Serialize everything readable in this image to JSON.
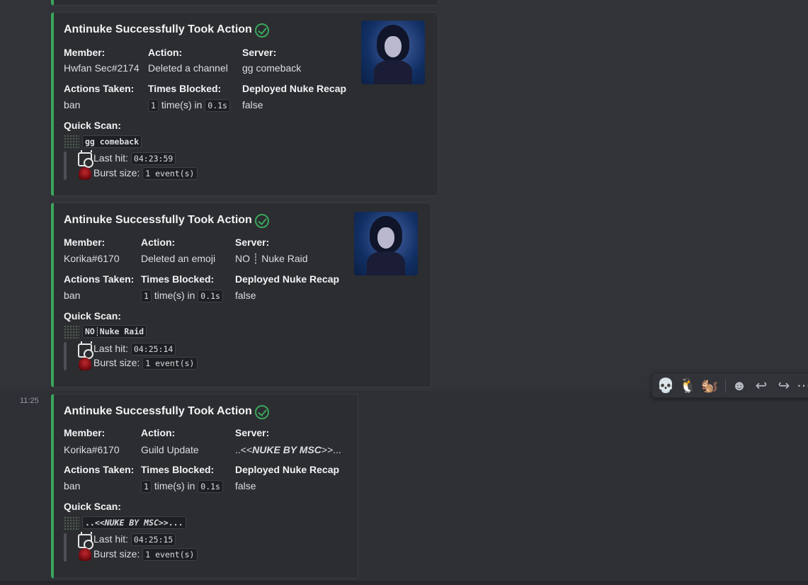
{
  "embeds": [
    {
      "title": "Antinuke Successfully Took Action",
      "member_label": "Member:",
      "member": "Hwfan Sec#2174",
      "action_label": "Action:",
      "action": "Deleted a channel",
      "server_label": "Server:",
      "server": "gg comeback",
      "actions_taken_label": "Actions Taken:",
      "actions_taken": "ban",
      "times_blocked_label": "Times Blocked:",
      "times_count": "1",
      "times_mid": "time(s) in",
      "times_dur": "0.1s",
      "recap_label": "Deployed Nuke Recap",
      "recap": "false",
      "quick_scan_label": "Quick Scan:",
      "scan_name": "gg comeback",
      "last_hit_label": "Last hit:",
      "last_hit": "04:23:59",
      "burst_label": "Burst size:",
      "burst": "1 event(s)"
    },
    {
      "title": "Antinuke Successfully Took Action",
      "member_label": "Member:",
      "member": "Korika#6170",
      "action_label": "Action:",
      "action": "Deleted an emoji",
      "server_label": "Server:",
      "server": "NO ┊ Nuke Raid",
      "actions_taken_label": "Actions Taken:",
      "actions_taken": "ban",
      "times_blocked_label": "Times Blocked:",
      "times_count": "1",
      "times_mid": "time(s) in",
      "times_dur": "0.1s",
      "recap_label": "Deployed Nuke Recap",
      "recap": "false",
      "quick_scan_label": "Quick Scan:",
      "scan_name": "NO┊Nuke Raid",
      "last_hit_label": "Last hit:",
      "last_hit": "04:25:14",
      "burst_label": "Burst size:",
      "burst": "1 event(s)"
    },
    {
      "title": "Antinuke Successfully Took Action",
      "member_label": "Member:",
      "member": "Korika#6170",
      "action_label": "Action:",
      "action": "Guild Update",
      "server_label": "Server:",
      "server_pre": "..<<",
      "server_em": "NUKE BY MSC",
      "server_post": ">>...",
      "actions_taken_label": "Actions Taken:",
      "actions_taken": "ban",
      "times_blocked_label": "Times Blocked:",
      "times_count": "1",
      "times_mid": "time(s) in",
      "times_dur": "0.1s",
      "recap_label": "Deployed Nuke Recap",
      "recap": "false",
      "quick_scan_label": "Quick Scan:",
      "scan_pre": "..<<",
      "scan_em": "NUKE BY MSC",
      "scan_post": ">>...",
      "last_hit_label": "Last hit:",
      "last_hit": "04:25:15",
      "burst_label": "Burst size:",
      "burst": "1 event(s)"
    }
  ],
  "message": {
    "timestamp": "11:25"
  },
  "toolbar": {
    "reactions": [
      "💀",
      "🐧",
      "🐿️"
    ],
    "icons": [
      "add-reaction-icon",
      "reply-icon",
      "forward-icon",
      "more-icon"
    ],
    "add_reaction": "☻",
    "reply": "↩",
    "forward": "↪",
    "more": "⋯"
  },
  "colors": {
    "accent": "#3ba55c",
    "embed_bg": "#2b2d31",
    "page_bg": "#313338"
  }
}
